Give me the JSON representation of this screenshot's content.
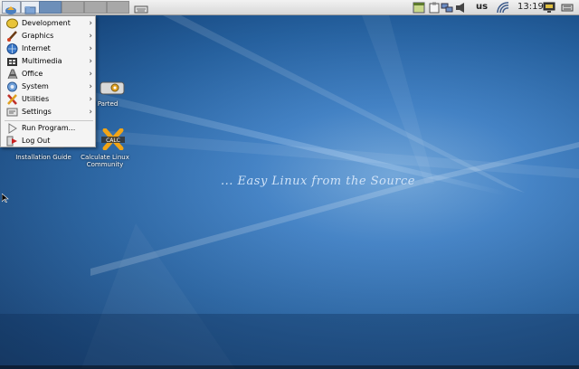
{
  "panel": {
    "workspaces": [
      "ws1",
      "ws2",
      "ws3",
      "ws4"
    ],
    "keyboard_layout": "us",
    "clock": "13:19",
    "icons": [
      "start-menu-icon",
      "file-manager-icon",
      "keyboard-icon",
      "notes-icon",
      "clipboard-icon",
      "network-icon",
      "volume-icon",
      "wifi-icon",
      "display-icon",
      "power-icon"
    ]
  },
  "menu": {
    "items": [
      {
        "label": "Development",
        "icon": "development-icon",
        "submenu": true
      },
      {
        "label": "Graphics",
        "icon": "graphics-icon",
        "submenu": true
      },
      {
        "label": "Internet",
        "icon": "internet-icon",
        "submenu": true
      },
      {
        "label": "Multimedia",
        "icon": "multimedia-icon",
        "submenu": true
      },
      {
        "label": "Office",
        "icon": "office-icon",
        "submenu": true
      },
      {
        "label": "System",
        "icon": "system-icon",
        "submenu": true
      },
      {
        "label": "Utilities",
        "icon": "utilities-icon",
        "submenu": true
      },
      {
        "label": "Settings",
        "icon": "settings-icon",
        "submenu": true
      },
      {
        "label": "Run Program...",
        "icon": "run-icon",
        "submenu": false
      },
      {
        "label": "Log Out",
        "icon": "logout-icon",
        "submenu": false
      }
    ],
    "arrow": "›"
  },
  "desktop": {
    "icons": [
      {
        "label_1": "Parted",
        "label_2": ""
      },
      {
        "label_1": "Installation Guide",
        "label_2": ""
      },
      {
        "label_1": "Calculate Linux",
        "label_2": "Community"
      }
    ],
    "tagline": "... Easy Linux from the Source"
  },
  "colors": {
    "panel_bg": "#e3e3e3",
    "active_workspace": "#6d8fb9",
    "desktop_blue": "#245f9d"
  }
}
